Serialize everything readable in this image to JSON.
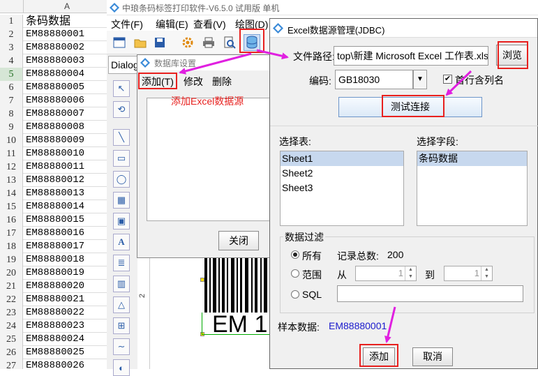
{
  "sheet": {
    "column_header": "A",
    "rows": [
      {
        "n": "1",
        "v": "条码数据"
      },
      {
        "n": "2",
        "v": "EM88880001"
      },
      {
        "n": "3",
        "v": "EM88880002"
      },
      {
        "n": "4",
        "v": "EM88880003"
      },
      {
        "n": "5",
        "v": "EM88880004"
      },
      {
        "n": "6",
        "v": "EM88880005"
      },
      {
        "n": "7",
        "v": "EM88880006"
      },
      {
        "n": "8",
        "v": "EM88880007"
      },
      {
        "n": "9",
        "v": "EM88880008"
      },
      {
        "n": "10",
        "v": "EM88880009"
      },
      {
        "n": "11",
        "v": "EM88880010"
      },
      {
        "n": "12",
        "v": "EM88880011"
      },
      {
        "n": "13",
        "v": "EM88880012"
      },
      {
        "n": "14",
        "v": "EM88880013"
      },
      {
        "n": "15",
        "v": "EM88880014"
      },
      {
        "n": "16",
        "v": "EM88880015"
      },
      {
        "n": "17",
        "v": "EM88880016"
      },
      {
        "n": "18",
        "v": "EM88880017"
      },
      {
        "n": "19",
        "v": "EM88880018"
      },
      {
        "n": "20",
        "v": "EM88880019"
      },
      {
        "n": "21",
        "v": "EM88880020"
      },
      {
        "n": "22",
        "v": "EM88880021"
      },
      {
        "n": "23",
        "v": "EM88880022"
      },
      {
        "n": "24",
        "v": "EM88880023"
      },
      {
        "n": "25",
        "v": "EM88880024"
      },
      {
        "n": "26",
        "v": "EM88880025"
      },
      {
        "n": "27",
        "v": "EM88880026"
      }
    ]
  },
  "app": {
    "title": "中琅条码标签打印软件-V6.5.0 试用版 单机",
    "menu": [
      "文件(F)",
      "编辑(E)",
      "查看(V)",
      "绘图(D)"
    ],
    "dialog_select": "Dialog",
    "canvas_text": "EM 1",
    "ruler_mark": "2"
  },
  "dbset": {
    "title": "数据库设置",
    "menu": {
      "add": "添加(T)",
      "edit": "修改",
      "delete": "删除"
    },
    "annotation": "添加Excel数据源",
    "close": "关闭"
  },
  "excel": {
    "title": "Excel数据源管理(JDBC)",
    "path_label": "文件路径:",
    "path_value": "top\\新建 Microsoft Excel 工作表.xls",
    "browse": "浏览",
    "encoding_label": "编码:",
    "encoding_value": "GB18030",
    "first_row_label": "首行含列名",
    "first_row_checked": true,
    "test_conn": "测试连接",
    "select_table_label": "选择表:",
    "tables": [
      "Sheet1",
      "Sheet2",
      "Sheet3"
    ],
    "selected_table": "Sheet1",
    "select_field_label": "选择字段:",
    "fields": [
      "条码数据"
    ],
    "filter_label": "数据过滤",
    "filter_all": "所有",
    "record_total_label": "记录总数:",
    "record_total": "200",
    "filter_range": "范围",
    "from_label": "从",
    "from_value": "1",
    "to_label": "到",
    "to_value": "1",
    "filter_sql": "SQL",
    "sample_label": "样本数据:",
    "sample_value": "EM88880001",
    "add": "添加",
    "cancel": "取消"
  },
  "colors": {
    "highlight_red": "#e8201e",
    "arrow_magenta": "#e020e0",
    "sample_blue": "#1a1acc",
    "accent_blue": "#2a5ca8"
  }
}
